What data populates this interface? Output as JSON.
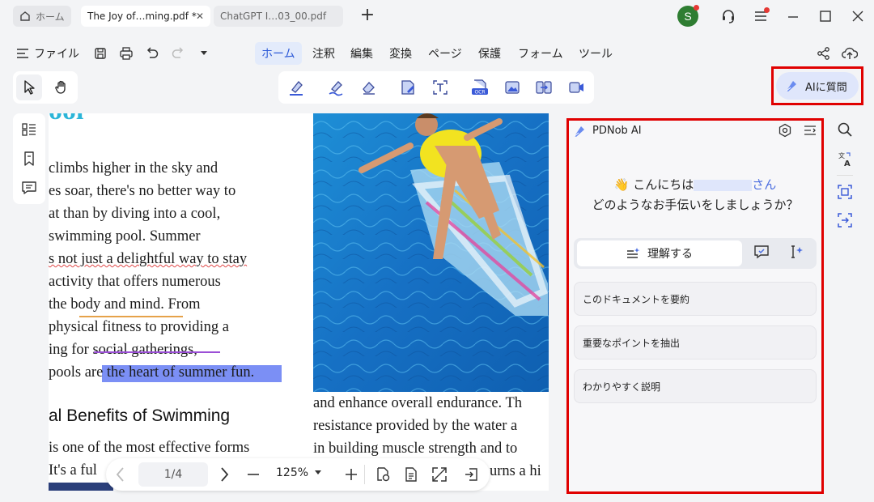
{
  "tabs": {
    "home_label": "ホーム",
    "active_label": "The Joy of…ming.pdf *",
    "inactive_label": "ChatGPT I…03_00.pdf",
    "close_glyph": "✕",
    "new_tab_glyph": "+"
  },
  "user": {
    "avatar_letter": "S"
  },
  "menu": {
    "file_label": "ファイル",
    "items": [
      "ホーム",
      "注釈",
      "編集",
      "変換",
      "ページ",
      "保護",
      "フォーム",
      "ツール"
    ]
  },
  "ask_ai_button": "AIに質問",
  "document": {
    "heading_fragment": "ool",
    "left_lines": [
      "climbs higher in the sky and",
      "es soar, there's no better way to",
      "at than by diving into a cool,",
      "swimming pool. Summer",
      "s not just a delightful way to stay",
      " activity that offers numerous",
      " the body and mind. From",
      "physical fitness to providing a",
      "ing for social gatherings,",
      "pools are the heart of summer fun."
    ],
    "section_heading": "al Benefits of Swimming",
    "bottom_left_lines": [
      "is one of the most effective forms",
      "It's a ful"
    ],
    "right_lines": [
      "and enhance overall endurance. Th",
      "resistance provided by the water a",
      "in building muscle strength and to",
      "urns a hi"
    ]
  },
  "ai_panel": {
    "title": "PDNob AI",
    "greeting_emoji": "👋",
    "greeting_prefix": "こんにちは",
    "greeting_suffix": "さん",
    "greeting_question": "どのようなお手伝いをしましょうか？",
    "mode_understand": "理解する",
    "suggestions": [
      "このドキュメントを要約",
      "重要なポイントを抽出",
      "わかりやすく説明"
    ]
  },
  "page_nav": {
    "page_indicator": "1/4",
    "zoom": "125%"
  },
  "colors": {
    "accent": "#2f5bd8",
    "highlight_box": "#e00000",
    "text_highlight": "#7b8ff5",
    "avatar": "#2e7d32"
  }
}
